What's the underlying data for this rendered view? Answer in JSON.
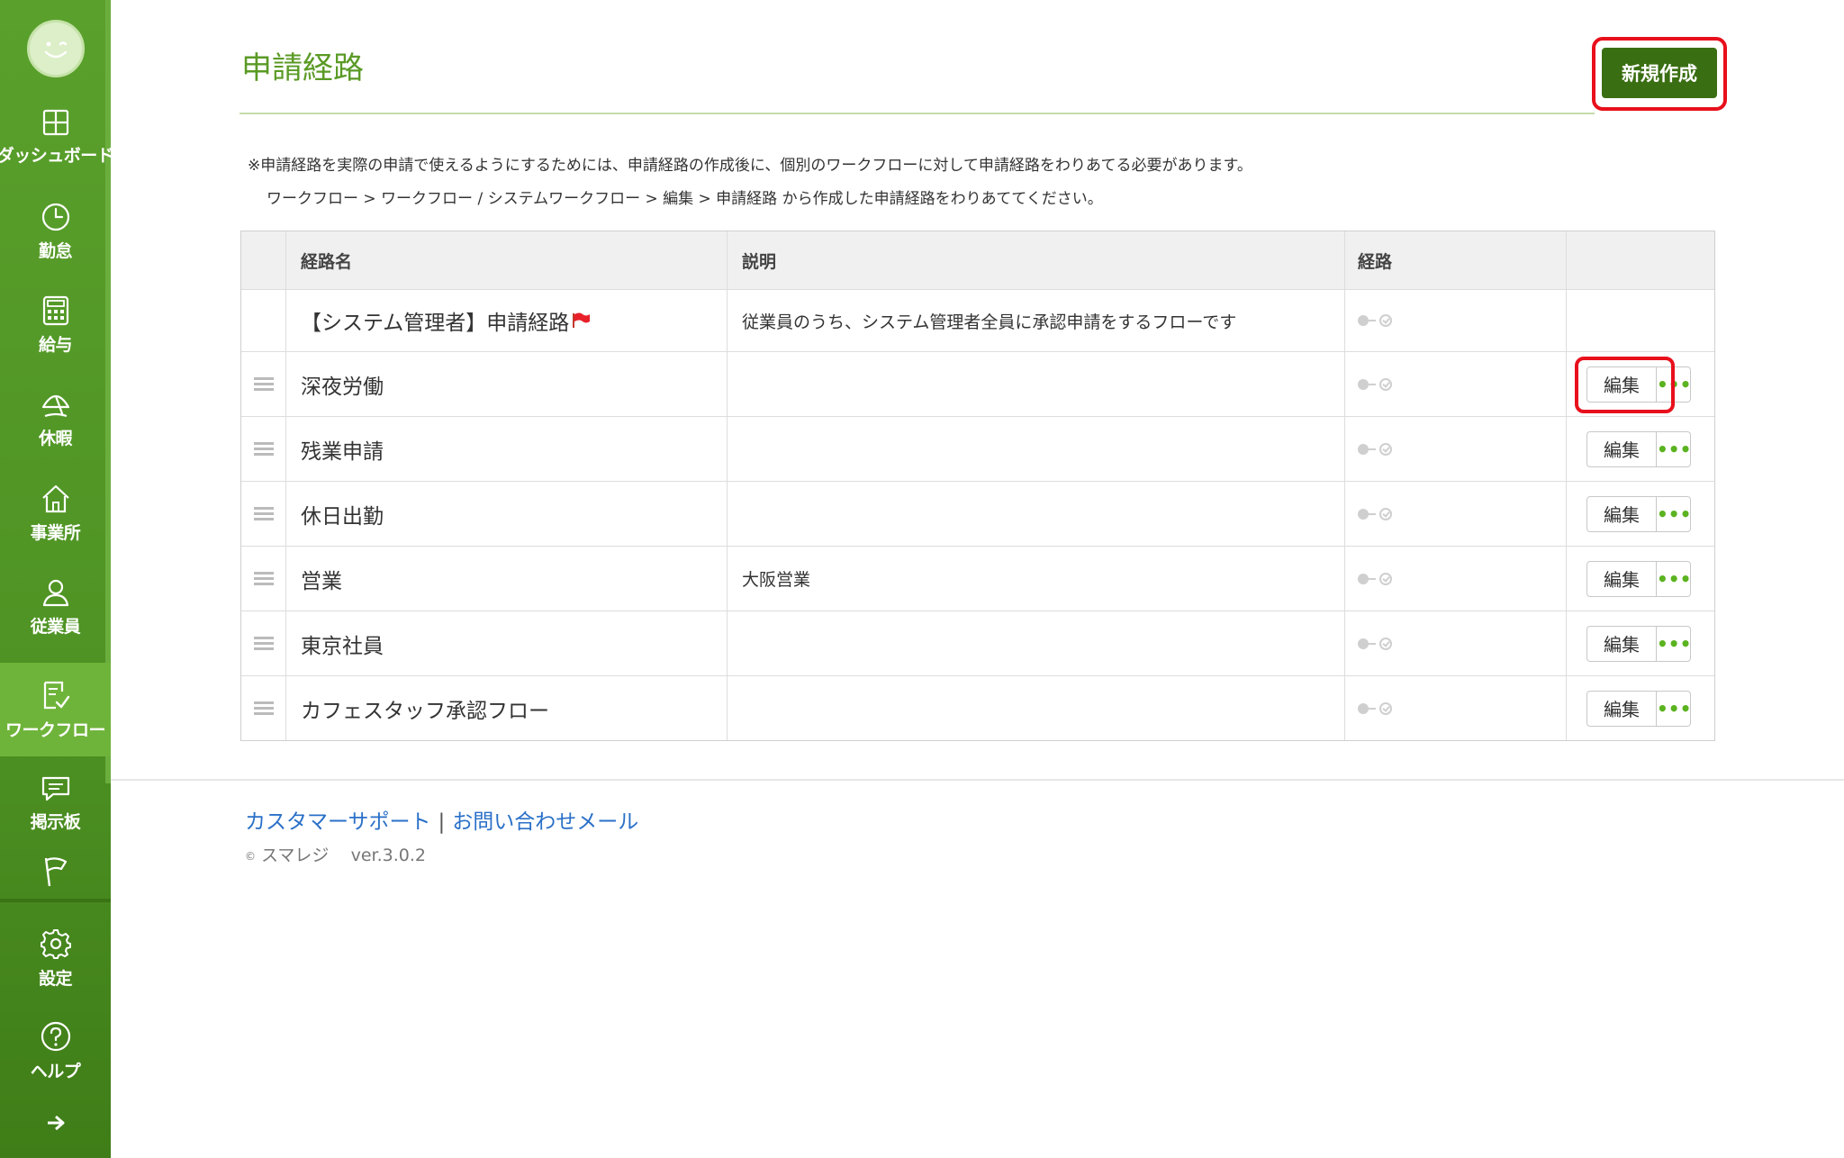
{
  "sidebar": {
    "items": [
      {
        "label": "ダッシュボード",
        "icon": "dashboard-icon"
      },
      {
        "label": "勤怠",
        "icon": "clock-icon"
      },
      {
        "label": "給与",
        "icon": "calculator-icon"
      },
      {
        "label": "休暇",
        "icon": "umbrella-icon"
      },
      {
        "label": "事業所",
        "icon": "home-icon"
      },
      {
        "label": "従業員",
        "icon": "person-icon"
      },
      {
        "label": "ワークフロー",
        "icon": "checklist-icon",
        "active": true
      },
      {
        "label": "掲示板",
        "icon": "chat-icon"
      },
      {
        "label": "",
        "icon": "flag-icon"
      },
      {
        "label": "設定",
        "icon": "gear-icon"
      },
      {
        "label": "ヘルプ",
        "icon": "help-icon"
      },
      {
        "label": "",
        "icon": "arrow-right-icon"
      }
    ]
  },
  "header": {
    "title": "申請経路",
    "new_button": "新規作成"
  },
  "notice": {
    "line1": "※申請経路を実際の申請で使えるようにするためには、申請経路の作成後に、個別のワークフローに対して申請経路をわりあてる必要があります。",
    "line2": "ワークフロー > ワークフロー / システムワークフロー > 編集 > 申請経路 から作成した申請経路をわりあててください。"
  },
  "table": {
    "columns": [
      "経路名",
      "説明",
      "経路"
    ],
    "rows": [
      {
        "name": "【システム管理者】申請経路",
        "description": "従業員のうち、システム管理者全員に承認申請をするフローです",
        "system": true
      },
      {
        "name": "深夜労働",
        "description": ""
      },
      {
        "name": "残業申請",
        "description": ""
      },
      {
        "name": "休日出勤",
        "description": ""
      },
      {
        "name": "営業",
        "description": "大阪営業"
      },
      {
        "name": "東京社員",
        "description": ""
      },
      {
        "name": "カフェスタッフ承認フロー",
        "description": ""
      }
    ],
    "edit_label": "編集",
    "more_label": "•••"
  },
  "footer": {
    "support_link": "カスタマーサポート",
    "separator": "|",
    "contact_link": "お問い合わせメール",
    "copyright_symbol": "©",
    "brand": "スマレジ",
    "version": "ver.3.0.2"
  },
  "colors": {
    "sidebar_green": "#5aa02c",
    "title_green": "#5a9a25",
    "button_dark_green": "#3a6e12",
    "highlight_red": "#e8101c",
    "link_blue": "#2a70c8"
  }
}
